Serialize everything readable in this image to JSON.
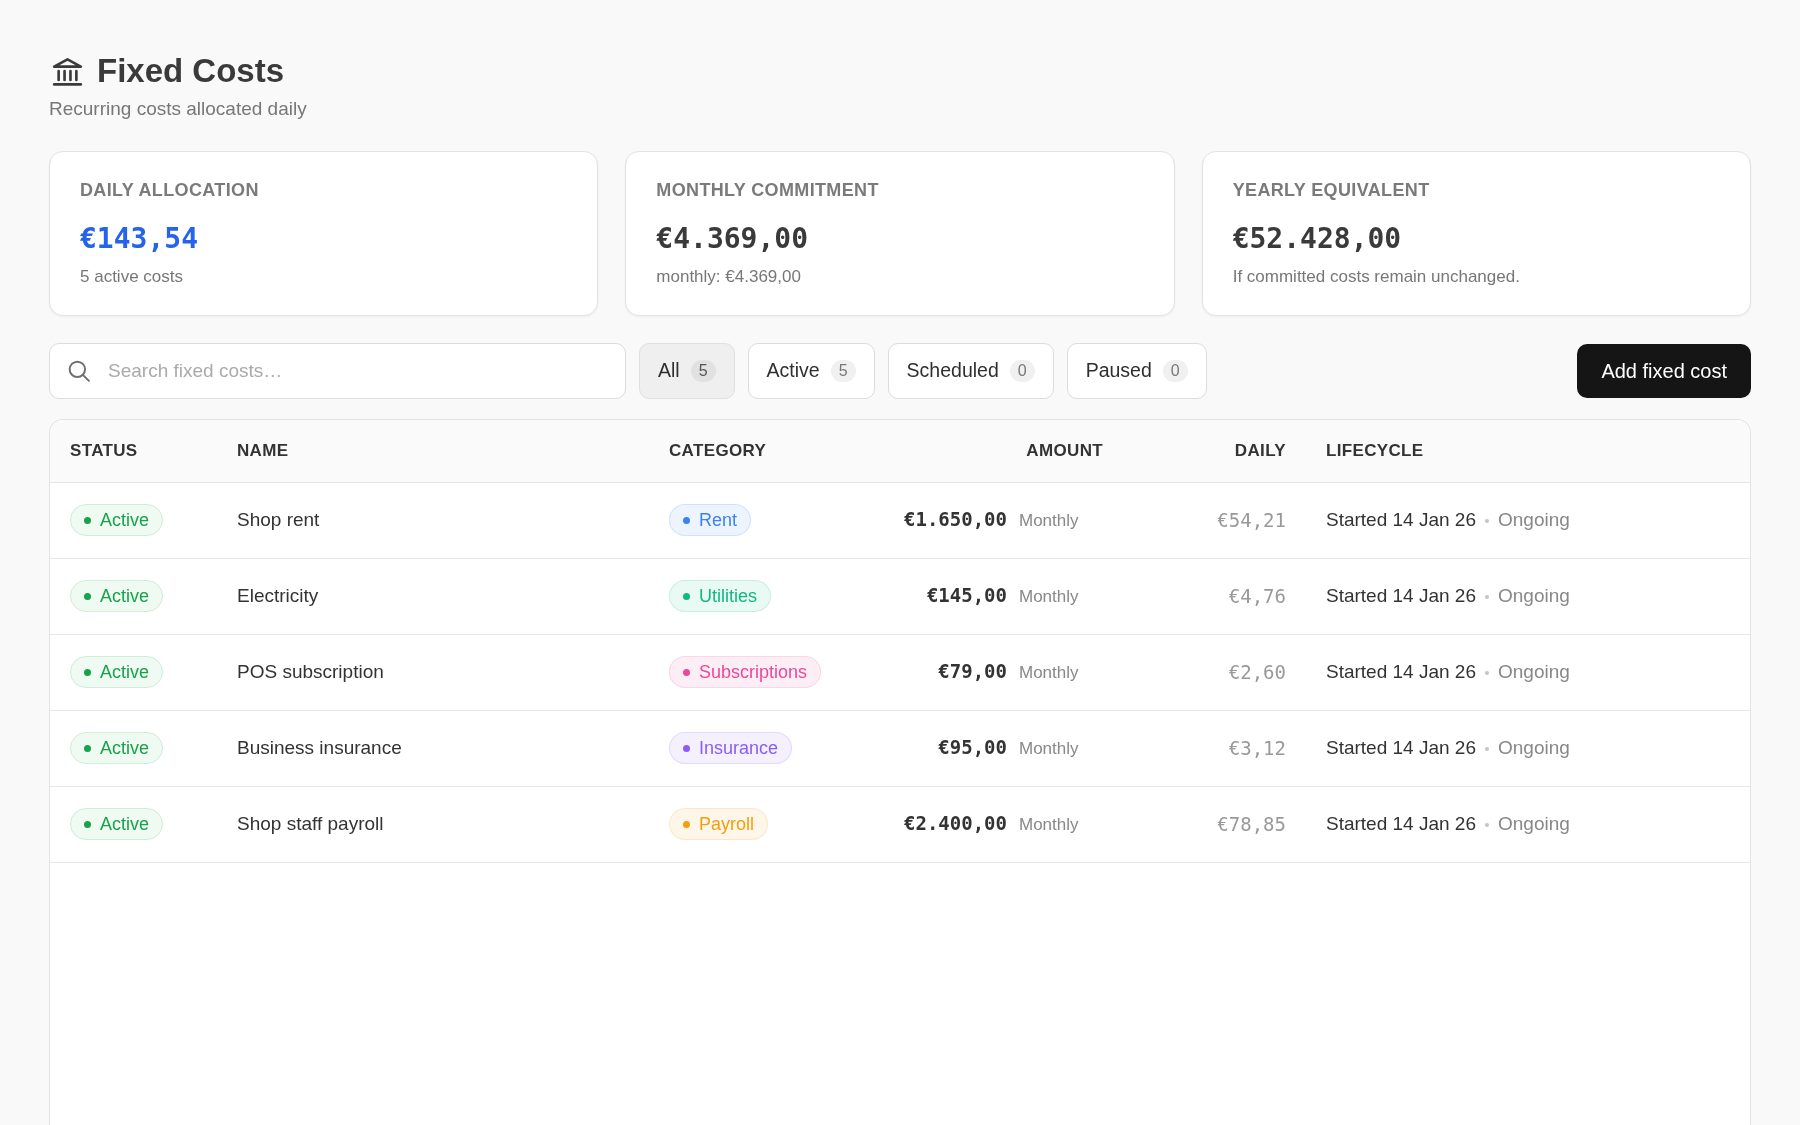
{
  "header": {
    "title": "Fixed Costs",
    "subtitle": "Recurring costs allocated daily"
  },
  "summary_cards": [
    {
      "label": "DAILY ALLOCATION",
      "value": "€143,54",
      "note": "5 active costs",
      "kind": "highlight"
    },
    {
      "label": "MONTHLY COMMITMENT",
      "value": "€4.369,00",
      "note": "monthly: €4.369,00",
      "kind": "plain"
    },
    {
      "label": "YEARLY EQUIVALENT",
      "value": "€52.428,00",
      "note": "If committed costs remain unchanged.",
      "kind": "plain"
    }
  ],
  "search": {
    "placeholder": "Search fixed costs…"
  },
  "filters": [
    {
      "label": "All",
      "count": "5",
      "selected": true
    },
    {
      "label": "Active",
      "count": "5",
      "selected": false
    },
    {
      "label": "Scheduled",
      "count": "0",
      "selected": false
    },
    {
      "label": "Paused",
      "count": "0",
      "selected": false
    }
  ],
  "add_button": {
    "label": "Add fixed cost"
  },
  "table": {
    "columns": [
      "STATUS",
      "NAME",
      "CATEGORY",
      "AMOUNT",
      "DAILY",
      "LIFECYCLE"
    ],
    "rows": [
      {
        "status": {
          "label": "Active",
          "kind": "active"
        },
        "name": "Shop rent",
        "category": {
          "label": "Rent",
          "color": "#3b82f6"
        },
        "amount": "€1.650,00",
        "frequency": "Monthly",
        "daily": "€54,21",
        "lifecycle": {
          "start": "Started 14 Jan 26",
          "end": "Ongoing"
        }
      },
      {
        "status": {
          "label": "Active",
          "kind": "active"
        },
        "name": "Electricity",
        "category": {
          "label": "Utilities",
          "color": "#10b981"
        },
        "amount": "€145,00",
        "frequency": "Monthly",
        "daily": "€4,76",
        "lifecycle": {
          "start": "Started 14 Jan 26",
          "end": "Ongoing"
        }
      },
      {
        "status": {
          "label": "Active",
          "kind": "active"
        },
        "name": "POS subscription",
        "category": {
          "label": "Subscriptions",
          "color": "#ec4899"
        },
        "amount": "€79,00",
        "frequency": "Monthly",
        "daily": "€2,60",
        "lifecycle": {
          "start": "Started 14 Jan 26",
          "end": "Ongoing"
        }
      },
      {
        "status": {
          "label": "Active",
          "kind": "active"
        },
        "name": "Business insurance",
        "category": {
          "label": "Insurance",
          "color": "#8b5cf6"
        },
        "amount": "€95,00",
        "frequency": "Monthly",
        "daily": "€3,12",
        "lifecycle": {
          "start": "Started 14 Jan 26",
          "end": "Ongoing"
        }
      },
      {
        "status": {
          "label": "Active",
          "kind": "active"
        },
        "name": "Shop staff payroll",
        "category": {
          "label": "Payroll",
          "color": "#f59e0b"
        },
        "amount": "€2.400,00",
        "frequency": "Monthly",
        "daily": "€78,85",
        "lifecycle": {
          "start": "Started 14 Jan 26",
          "end": "Ongoing"
        }
      }
    ]
  }
}
